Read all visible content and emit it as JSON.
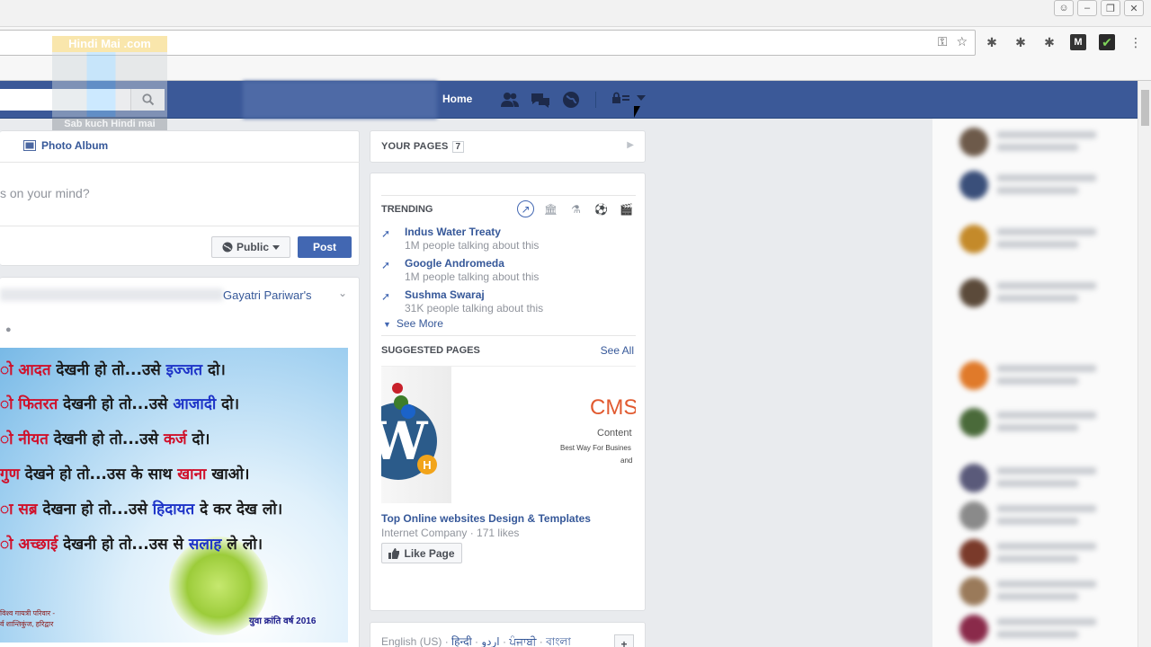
{
  "browser": {
    "extension_m_label": "M"
  },
  "watermark": {
    "top": "Hindi Mai .com",
    "bottom": "Sab kuch Hindi mai"
  },
  "fb_nav": {
    "home_label": "Home",
    "brand_color": "#3b5998"
  },
  "composer": {
    "tab_photo_album": "Photo Album",
    "placeholder": "s on your mind?",
    "privacy_label": "Public",
    "post_label": "Post"
  },
  "post": {
    "source": "Gayatri Pariwar's",
    "image": {
      "lines": [
        {
          "pre": "",
          "hl": "ो आदत",
          "hlc": "red",
          "mid": " देखनी हो तो...उसे ",
          "hl2": "इज्जत",
          "hl2c": "blue",
          "post": " दो।"
        },
        {
          "pre": "",
          "hl": "ो फितरत",
          "hlc": "red",
          "mid": " देखनी हो तो...उसे ",
          "hl2": "आजादी",
          "hl2c": "blue",
          "post": " दो।"
        },
        {
          "pre": "",
          "hl": "ो नीयत",
          "hlc": "red",
          "mid": " देखनी हो तो...उसे ",
          "hl2": "कर्ज",
          "hl2c": "red",
          "post": " दो।"
        },
        {
          "pre": "",
          "hl": "गुण",
          "hlc": "red",
          "mid": " देखने हो तो...उस के साथ ",
          "hl2": "खाना",
          "hl2c": "red",
          "post": " खाओ।"
        },
        {
          "pre": "",
          "hl": "ा सब्र",
          "hlc": "red",
          "mid": " देखना हो तो...उसे ",
          "hl2": "हिदायत",
          "hl2c": "blue",
          "post": " दे कर देख लो।"
        },
        {
          "pre": "",
          "hl": "ो अच्छाई",
          "hlc": "red",
          "mid": " देखनी हो तो...उस से ",
          "hl2": "सलाह",
          "hl2c": "blue",
          "post": " ले लो।"
        }
      ],
      "footer_left_1": "विश्व गायत्री परिवार -",
      "footer_left_2": "र्व शान्तिकुंज, हरिद्वार",
      "footer_right": "युवा क्रांति वर्ष 2016"
    }
  },
  "your_pages": {
    "label": "YOUR PAGES",
    "count": "7"
  },
  "trending": {
    "heading": "TRENDING",
    "items": [
      {
        "title": "Indus Water Treaty",
        "sub": "1M people talking about this"
      },
      {
        "title": "Google Andromeda",
        "sub": "1M people talking about this"
      },
      {
        "title": "Sushma Swaraj",
        "sub": "31K people talking about this"
      }
    ],
    "see_more": "See More"
  },
  "suggested": {
    "heading": "SUGGESTED PAGES",
    "see_all": "See All",
    "ad": {
      "cms": "CMS",
      "content": "Content",
      "tagline": "Best Way For Busines",
      "and": "and",
      "title": "Top Online websites Design & Templates",
      "meta": "Internet Company · 171 likes",
      "like_label": "Like Page"
    }
  },
  "languages": {
    "current": "English (US)",
    "others": [
      "हिन्दी",
      "اردو",
      "ਪੰਜਾਬੀ",
      "বাংলা"
    ],
    "add": "+"
  }
}
